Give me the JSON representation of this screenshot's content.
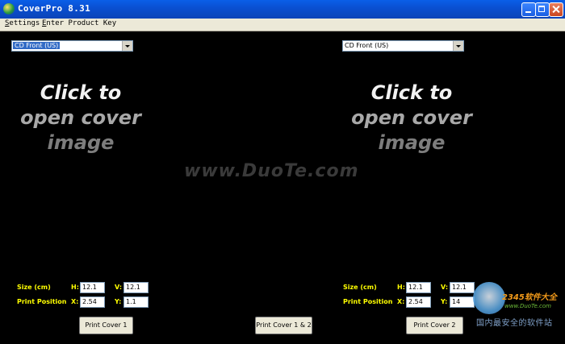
{
  "window": {
    "title": "CoverPro 8.31"
  },
  "menu": {
    "settings": "Settings",
    "product_key": "Enter Product Key"
  },
  "left_panel": {
    "cover_type": "CD Front (US)",
    "placeholder": {
      "line1": "Click to",
      "line2": "open cover",
      "line3": "image"
    },
    "size_label": "Size (cm)",
    "print_position_label": "Print Position",
    "h_label": "H:",
    "v_label": "V:",
    "x_label": "X:",
    "y_label": "Y:",
    "h": "12.1",
    "v": "12.1",
    "x": "2.54",
    "y": "1.1",
    "print_button": "Print Cover 1"
  },
  "right_panel": {
    "cover_type": "CD Front (US)",
    "placeholder": {
      "line1": "Click to",
      "line2": "open cover",
      "line3": "image"
    },
    "size_label": "Size (cm)",
    "print_position_label": "Print Position",
    "h_label": "H:",
    "v_label": "V:",
    "x_label": "X:",
    "y_label": "Y:",
    "h": "12.1",
    "v": "12.1",
    "x": "2.54",
    "y": "14",
    "print_button": "Print Cover 2"
  },
  "print_both_button": "Print Cover 1 & 2",
  "watermark": "www.DuoTe.com",
  "corner_watermark": {
    "brand": "2345软件大全",
    "url": "www.DuoTe.com",
    "tagline": "国内最安全的软件站"
  }
}
